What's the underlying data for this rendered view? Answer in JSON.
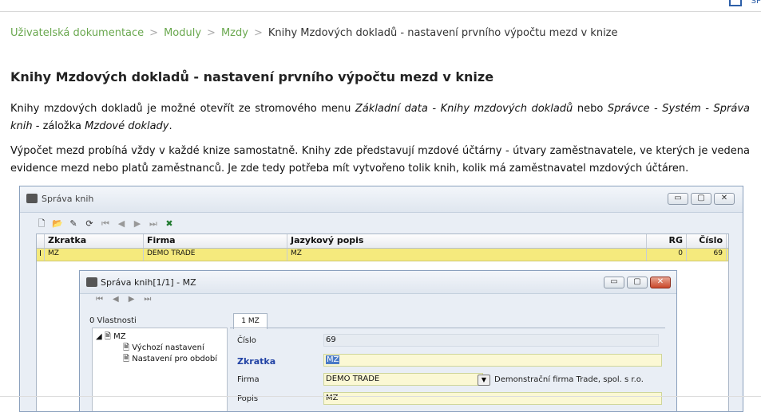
{
  "topbar": {
    "right_text": "SP"
  },
  "breadcrumb": {
    "items": [
      "Uživatelská dokumentace",
      "Moduly",
      "Mzdy"
    ],
    "current": "Knihy Mzdových dokladů - nastavení prvního výpočtu mezd v knize",
    "separator": ">"
  },
  "page_title": "Knihy Mzdových dokladů - nastavení prvního výpočtu mezd v knize",
  "para1": {
    "t1": "Knihy mzdových dokladů je možné otevřít ze stromového menu ",
    "i1": "Základní data - Knihy mzdových dokladů",
    "t2": " nebo ",
    "i2": "Správce - Systém - Správa knih",
    "t3": " - záložka ",
    "i3": "Mzdové doklady",
    "t4": "."
  },
  "para2": "Výpočet mezd probíhá vždy v každé knize samostatně. Knihy zde představují mzdové účtárny - útvary zaměstnavatele, ve kterých je vedena evidence mezd nebo platů zaměstnanců. Je zde tedy potřeba mít vytvořeno tolik knih, kolik má zaměstnavatel mzdových účtáren.",
  "outer_window": {
    "title": "Správa knih",
    "buttons": {
      "minimize": "▭",
      "maximize": "▢",
      "close": "✕"
    },
    "grid": {
      "columns": [
        "Zkratka",
        "Firma",
        "Jazykový popis",
        "RG",
        "Číslo"
      ],
      "rows": [
        {
          "marker": "I",
          "zkratka": "MZ",
          "firma": "DEMO TRADE",
          "popis": "MZ",
          "rg": "0",
          "cislo": "69"
        }
      ]
    }
  },
  "inner_window": {
    "title": "Správa knih[1/1] - MZ",
    "buttons": {
      "minimize": "▭",
      "maximize": "▢",
      "close": "✕"
    },
    "left_label": "0 Vlastnosti",
    "tree": {
      "root": "MZ",
      "children": [
        "Výchozí nastavení",
        "Nastavení pro období"
      ]
    },
    "tab": "1 MZ",
    "fields": {
      "cislo_label": "Číslo",
      "cislo_value": "69",
      "zkratka_label": "Zkratka",
      "zkratka_value": "MZ",
      "firma_label": "Firma",
      "firma_value": "DEMO TRADE",
      "firma_desc": "Demonstrační firma Trade, spol. s r.o.",
      "popis_label": "Popis",
      "popis_value": "MZ"
    }
  },
  "colors": {
    "breadcrumb_link": "#6aa84f",
    "selected_row": "#f5ea7d",
    "bold_label": "#2243a5"
  }
}
